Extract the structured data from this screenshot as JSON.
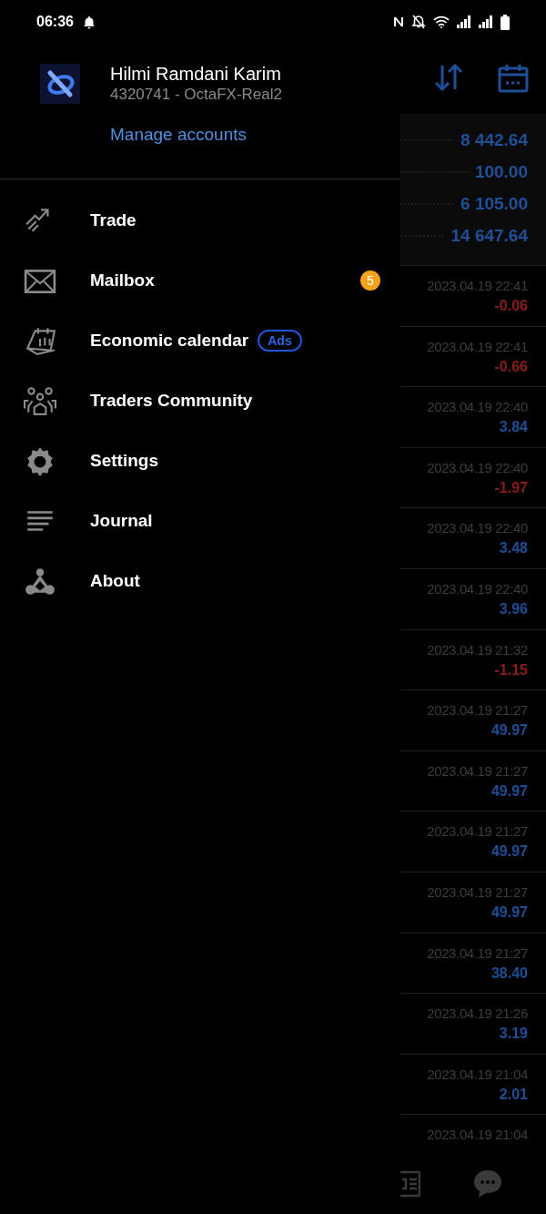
{
  "status_bar": {
    "time": "06:36"
  },
  "account": {
    "name": "Hilmi Ramdani Karim",
    "number": "4320741 - OctaFX-Real2",
    "link": "Manage accounts"
  },
  "menu": [
    {
      "label": "Trade"
    },
    {
      "label": "Mailbox",
      "badge": "5"
    },
    {
      "label": "Economic calendar",
      "tag": "Ads"
    },
    {
      "label": "Traders Community"
    },
    {
      "label": "Settings"
    },
    {
      "label": "Journal"
    },
    {
      "label": "About"
    }
  ],
  "balances": [
    "8 442.64",
    "100.00",
    "6 105.00",
    "14 647.64"
  ],
  "trades": [
    {
      "time": "2023.04.19 22:41",
      "profit": "-0.06",
      "color": "#8b1c1c"
    },
    {
      "time": "2023.04.19 22:41",
      "profit": "-0.66",
      "color": "#8b1c1c"
    },
    {
      "time": "2023.04.19 22:40",
      "profit": "3.84",
      "color": "#1d4e96"
    },
    {
      "time": "2023.04.19 22:40",
      "profit": "-1.97",
      "color": "#8b1c1c"
    },
    {
      "time": "2023.04.19 22:40",
      "profit": "3.48",
      "color": "#1d4e96"
    },
    {
      "time": "2023.04.19 22:40",
      "profit": "3.96",
      "color": "#1d4e96"
    },
    {
      "time": "2023.04.19 21:32",
      "profit": "-1.15",
      "color": "#8b1c1c"
    },
    {
      "time": "2023.04.19 21:27",
      "profit": "49.97",
      "color": "#1d4e96"
    },
    {
      "time": "2023.04.19 21:27",
      "profit": "49.97",
      "color": "#1d4e96"
    },
    {
      "time": "2023.04.19 21:27",
      "profit": "49.97",
      "color": "#1d4e96"
    },
    {
      "time": "2023.04.19 21:27",
      "profit": "49.97",
      "color": "#1d4e96"
    },
    {
      "time": "2023.04.19 21:27",
      "profit": "38.40",
      "color": "#1d4e96"
    },
    {
      "time": "2023.04.19 21:26",
      "profit": "3.19",
      "color": "#1d4e96"
    },
    {
      "time": "2023.04.19 21:04",
      "profit": "2.01",
      "color": "#1d4e96"
    },
    {
      "time": "2023.04.19 21:04"
    }
  ]
}
